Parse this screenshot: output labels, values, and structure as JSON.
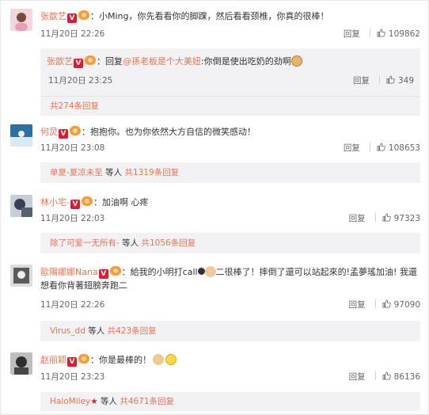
{
  "comments": [
    {
      "user": "张歆艺",
      "text": "：小Ming，你先看看你的脚踝，然后看看颈椎，你真的很棒！",
      "time": "11月20日 22:26",
      "reply_label": "回复",
      "likes": "109862",
      "avatar_colors": [
        "#e9a0b0",
        "#7a4a3a"
      ],
      "sub_reply": {
        "user": "张歆艺",
        "text_prefix": "：回复",
        "mention": "@孫老板是个大美妞",
        "text_suffix": ":你倒是使出吃奶的劲啊",
        "time": "11月20日 23:25",
        "reply_label": "回复",
        "likes": "349"
      },
      "more": "共274条回复"
    },
    {
      "user": "何炅",
      "text": "：抱抱你。也为你依然大方自信的微笑感动！",
      "time": "11月20日 23:08",
      "reply_label": "回复",
      "likes": "108653",
      "avatar_colors": [
        "#2b6fa8",
        "#d9e9f5"
      ],
      "more_user": "单夏-夏凉未至",
      "more_mid": " 等人 ",
      "more": "共1319条回复"
    },
    {
      "user": "林小宅-",
      "text": "：加油啊 心疼",
      "time": "11月20日 22:03",
      "reply_label": "回复",
      "likes": "97323",
      "avatar_colors": [
        "#3a3f55",
        "#c9cdd6"
      ],
      "more_user": "除了可爱一无所有-",
      "more_mid": " 等人 ",
      "more": "共1056条回复"
    },
    {
      "user": "歐陽娜娜Nana",
      "text_line1": "：給我的小明打call",
      "text_line1b": "二很棒了！摔倒了還可以站起來的!孟夢瑤加油! 我還",
      "text_line2": "想看你背著翅膀奔跑二",
      "time": "11月20日 22:26",
      "reply_label": "回复",
      "likes": "97090",
      "avatar_colors": [
        "#5a5a5a",
        "#dcdcdc"
      ],
      "more_user": "Virus_dd",
      "more_mid": " 等人 ",
      "more": "共423条回复"
    },
    {
      "user": "赵丽颖",
      "text": "：你是最棒的！",
      "time": "11月20日 23:23",
      "reply_label": "回复",
      "likes": "86136",
      "avatar_colors": [
        "#2e2e2e",
        "#bdbdbd"
      ],
      "more_user": "HaloMiley",
      "more_mid": " 等人 ",
      "more": "共4671条回复"
    }
  ],
  "badge_v": "V"
}
